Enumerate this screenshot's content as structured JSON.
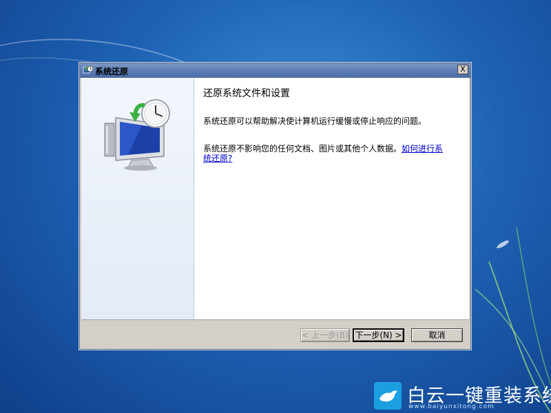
{
  "window": {
    "title": "系统还原",
    "close_symbol": "X"
  },
  "main": {
    "heading": "还原系统文件和设置",
    "description": "系统还原可以帮助解决使计算机运行缓慢或停止响应的问题。",
    "note": "系统还原不影响您的任何文档、图片或其他个人数据。",
    "help_link": "如何进行系统还原?"
  },
  "buttons": {
    "back_label": "< 上一步(B)",
    "next_label": "下一步(N) >",
    "cancel_label": "取消"
  },
  "watermark": {
    "brand": "白云一键重装系统",
    "url": "www.baiyunxitong.com"
  },
  "colors": {
    "desktop": "#1f63b5",
    "titlebar": "#5f7fb6",
    "link": "#0000cc",
    "watermark_icon": "#1a9fe1"
  }
}
